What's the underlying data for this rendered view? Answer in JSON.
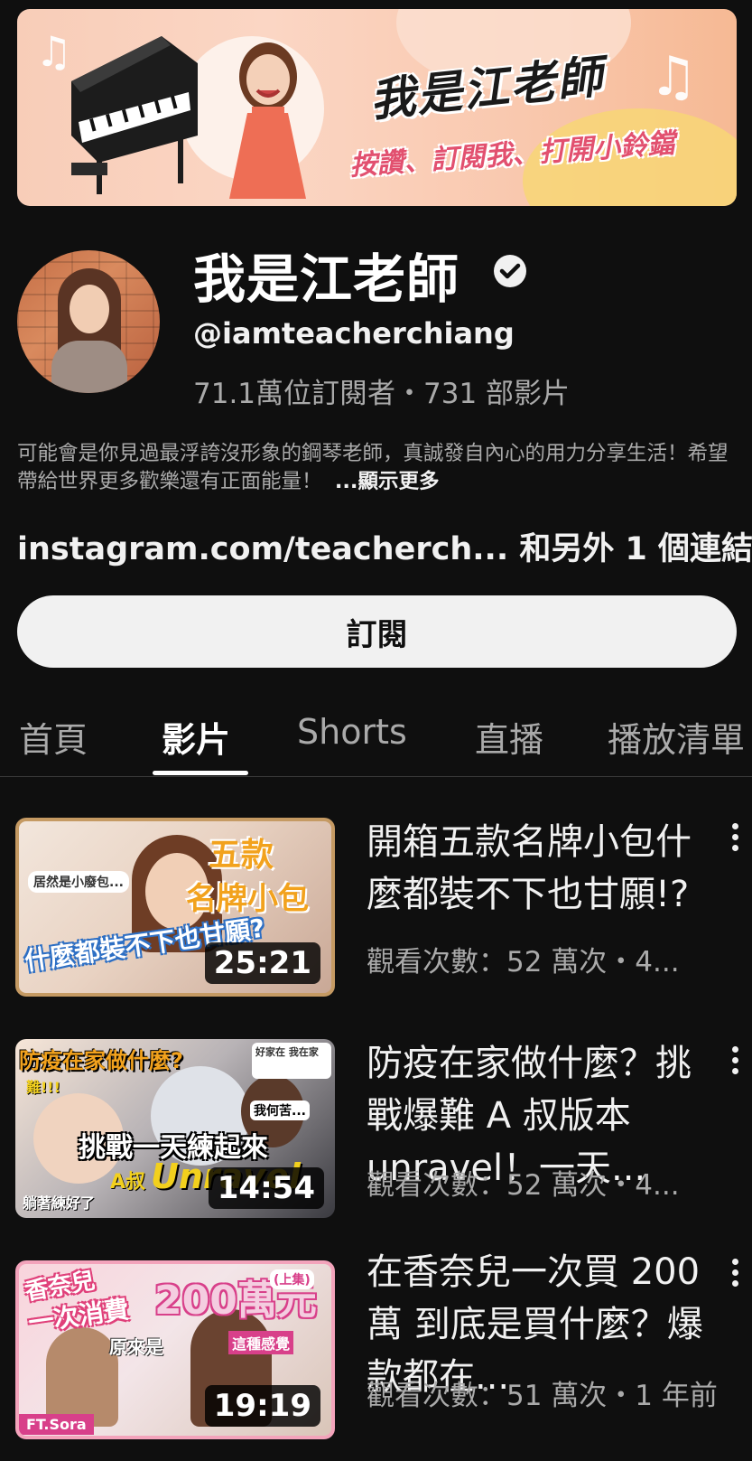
{
  "banner": {
    "title": "我是江老師",
    "subtitle": "按讚、訂閱我、打開小鈴鐺"
  },
  "channel": {
    "name": "我是江老師",
    "handle": "@iamteacherchiang",
    "stats": "71.1萬位訂閱者・731 部影片",
    "description": "可能會是你見過最浮誇沒形象的鋼琴老師，真誠發自內心的用力分享生活！希望帶給世界更多歡樂還有正面能量！",
    "show_more": "...顯示更多",
    "links": "instagram.com/teacherch... 和另外 1 個連結",
    "subscribe_label": "訂閱"
  },
  "tabs": [
    {
      "label": "首頁"
    },
    {
      "label": "影片"
    },
    {
      "label": "Shorts"
    },
    {
      "label": "直播"
    },
    {
      "label": "播放清單"
    }
  ],
  "active_tab": "影片",
  "videos": [
    {
      "title": "開箱五款名牌小包什麼都裝不下也甘願!?",
      "meta": "觀看次數：52 萬次・4...",
      "duration": "25:21",
      "thumb_text": [
        "五款",
        "名牌小包",
        "什麼都裝不下也甘願?",
        "居然是小廢包..."
      ]
    },
    {
      "title": "防疫在家做什麼？挑戰爆難 A 叔版本 unravel！一天...",
      "meta": "觀看次數：52 萬次・4...",
      "duration": "14:54",
      "thumb_text": [
        "防疫在家做什麼?",
        "挑戰一天練起來",
        "A叔",
        "Unravel",
        "躺著練好了",
        "我何苦...",
        "難!!!",
        "好家在 我在家"
      ]
    },
    {
      "title": "在香奈兒一次買 200 萬 到底是買什麼？爆款都在...",
      "meta": "觀看次數：51 萬次・1 年前",
      "duration": "19:19",
      "thumb_text": [
        "香奈兒",
        "一次消費",
        "200萬元",
        "(上集)",
        "原來是",
        "這種感覺",
        "FT.Sora"
      ]
    }
  ],
  "colors": {
    "background": "#0f0f0f",
    "text_primary": "#f1f1f1",
    "text_secondary": "#aaaaaa",
    "subscribe_bg": "#f1f1f1"
  },
  "icons": [
    "verified-icon",
    "more-vert-icon"
  ]
}
